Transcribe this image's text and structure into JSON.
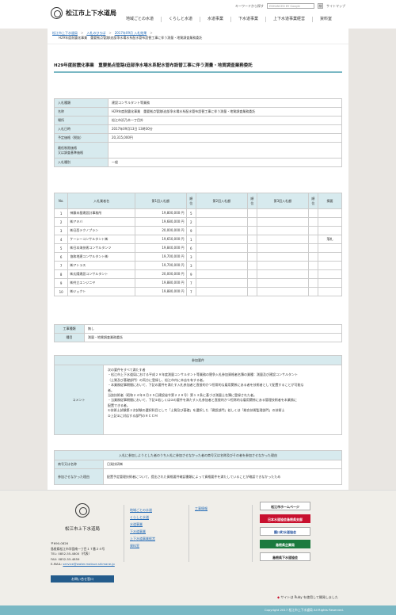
{
  "header": {
    "site_name": "松江市上下水道局",
    "search_placeholder": "ENHANCED BY Google",
    "search_button": "検",
    "util_font": "キーワードから探す",
    "sitemap": "サイトマップ",
    "nav": [
      "地域ごとの水道",
      "くらしと水道",
      "水道事業",
      "下水道事業",
      "上下水道事業経営",
      "資料室"
    ]
  },
  "breadcrumb": {
    "items": [
      "松江市上下水道局",
      "入札のひろば",
      "2017年09月 入札結果"
    ],
    "current": "H29年度耐震化事業　重要拠点管路I迫部浄水場水系配水管布設替工事に伴う測量・地質調査業務委託"
  },
  "page_title": "H29年度耐震化事業　重要拠点管路I迫部浄水場水系配水管布設替工事に伴う測量・地質調査業務委託",
  "info": [
    {
      "label": "入札種類",
      "value": "建設コンサルタント等業務"
    },
    {
      "label": "名称",
      "value": "H29年度耐震化事業　重要拠点管路I迫部浄水場水系配水管布設替工事に伴う測量・地質調査業務委託"
    },
    {
      "label": "場所",
      "value": "松江市浜乃木一丁目外"
    },
    {
      "label": "入札日時",
      "value": "2017年09月13日 13時30分"
    },
    {
      "label": "予定価格（税抜）",
      "value": "20,315,000円"
    },
    {
      "label": "最低制限価格\n又は調査基準価格",
      "value": ""
    },
    {
      "label": "入札種別",
      "value": "一般"
    }
  ],
  "bids": {
    "headers": {
      "no": "No.",
      "name": "入札業者名",
      "first": "第1回入札額",
      "rank": "順位",
      "second": "第2回入札額",
      "third": "第3回入札額",
      "note": "摘要"
    },
    "rows": [
      {
        "no": "1",
        "name": "神藤未基建設計事務所",
        "amount": "19,800,000 円",
        "rank": "5",
        "note": ""
      },
      {
        "no": "2",
        "name": "㈱アキバ",
        "amount": "19,680,000 円",
        "rank": "2",
        "note": ""
      },
      {
        "no": "3",
        "name": "㈱日西テクノプラン",
        "amount": "20,000,000 円",
        "rank": "9",
        "note": ""
      },
      {
        "no": "4",
        "name": "ケーシーコンサルタント㈱",
        "amount": "19,650,000 円",
        "rank": "1",
        "note": "落札"
      },
      {
        "no": "5",
        "name": "㈱日本海技術コンサルタンツ",
        "amount": "19,840,000 円",
        "rank": "6",
        "note": ""
      },
      {
        "no": "6",
        "name": "協和地建コンサルタント㈱",
        "amount": "19,700,000 円",
        "rank": "3",
        "note": ""
      },
      {
        "no": "7",
        "name": "㈱アトラス",
        "amount": "19,700,000 円",
        "rank": "3",
        "note": ""
      },
      {
        "no": "8",
        "name": "㈱太陽建設コンサルタント",
        "amount": "20,000,000 円",
        "rank": "9",
        "note": ""
      },
      {
        "no": "9",
        "name": "㈱共立エンジニヤ",
        "amount": "19,880,000 円",
        "rank": "7",
        "note": ""
      },
      {
        "no": "10",
        "name": "㈱ジェクト",
        "amount": "19,880,000 円",
        "rank": "7",
        "note": ""
      }
    ]
  },
  "work": [
    {
      "label": "工事種類",
      "value": "無し"
    },
    {
      "label": "種目",
      "value": "測量・地質調査業務委託"
    }
  ],
  "requirements": {
    "header": "参加要件",
    "label": "コメント",
    "lines": [
      "次の要件をすべて満たす者",
      "・松江市上下水道局における平成２９年度測量コンサルタント等業務の競争入札参加資格者名簿の業種：測量及び建設コンサルタント",
      "（土質及び基礎部門）の両方に登録し、松江市内に本店を有する者。",
      "・本業務従事期間において、下記の要件を満たす入札参加者と直接的かつ恒常的な雇用関係にある者を技術者として配置することが可能な",
      "者。",
      "当該技術者（昭和２４年８月２５日建設省令第２２８号）第１３条に基づき測量士名簿に登録された者。",
      "・当業務従事期間において、下記①若しくは②の要件を満たす入札参加者と直接的かつ恒常的な雇用関係にある管理技術者を本業務に",
      "配置できる者。",
      "①技術士試験第２次試験の選択科目として「土質及び基礎」を選択した「建設部門」若しくは「総合技術監理部門」の技術士",
      "②上記①に対応する部門のＲＣＣＭ"
    ]
  },
  "disqualified": {
    "header": "入札に参加しようとした者のうち入札に参加させなかった者の商号又は名称及びその者を参加させなかった理由",
    "rows": [
      {
        "label": "商号又は名称",
        "value": "日発技研㈱"
      },
      {
        "label": "参加させなかった理由",
        "value": "配置予定管理技術者について、提出された資格要件確認書類によって資格要件を満たしていることが確認できなかったため"
      }
    ]
  },
  "footer": {
    "name": "松江市上下水道局",
    "address_lines": [
      "〒690-0826",
      "島根県松江市学園南一丁目１７番２４号",
      "TEL: 0852-55-4800（代表）",
      "FAX: 0852-55-4859"
    ],
    "email_label": "E-MAIL:",
    "email": "service@water.matsue.shimane.jp",
    "contact_button": "お問い合せ窓口",
    "links_col1": [
      "地域ごとの水道",
      "くらしと水道",
      "水道事業",
      "下水道事業",
      "上下水道事業経営",
      "資料室"
    ],
    "links_col2": [
      "工事情報"
    ],
    "banners": [
      "松江市ホームページ",
      "日本水道協会島根県支部",
      "簸川町水道協会",
      "島根県企業局",
      "島根県下水道協会"
    ],
    "note": "サイトは Ruby を使用して開発しました",
    "copyright": "Copyright 2017 松江市上下水道局 All Rights Reserved."
  }
}
